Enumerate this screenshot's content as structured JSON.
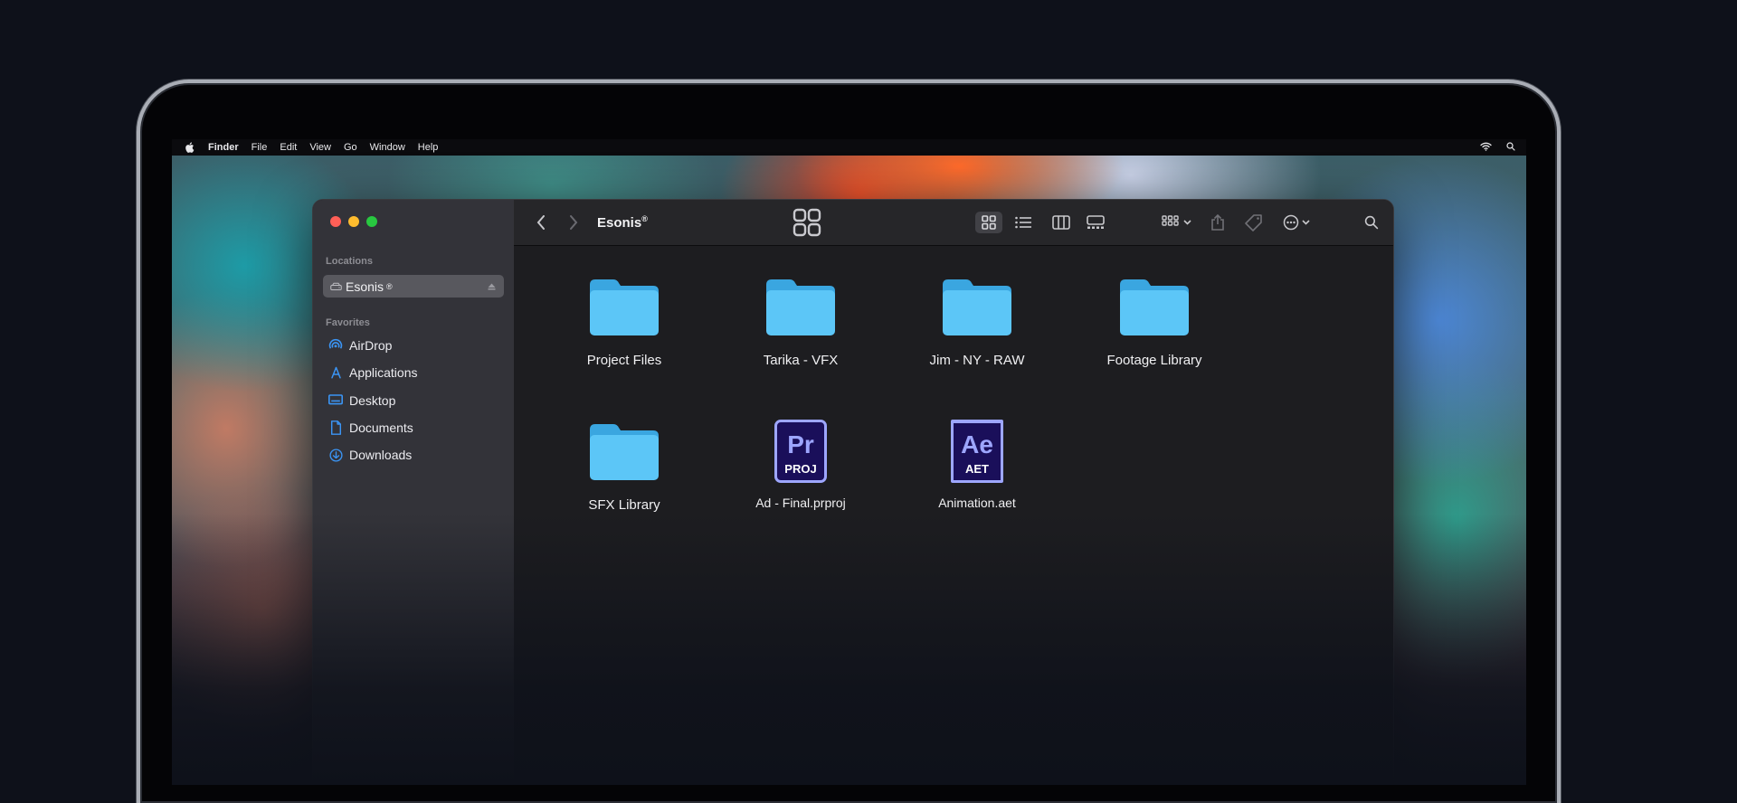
{
  "menubar": {
    "items": [
      "Finder",
      "File",
      "Edit",
      "View",
      "Go",
      "Window",
      "Help"
    ]
  },
  "window": {
    "title": "Esonis",
    "title_mark": "®"
  },
  "sidebar": {
    "locations_label": "Locations",
    "location": {
      "label": "Esonis",
      "mark": "®",
      "icon": "drive-icon"
    },
    "favorites_label": "Favorites",
    "favorites": [
      {
        "label": "AirDrop",
        "icon": "airdrop-icon"
      },
      {
        "label": "Applications",
        "icon": "applications-icon"
      },
      {
        "label": "Desktop",
        "icon": "desktop-icon"
      },
      {
        "label": "Documents",
        "icon": "document-icon"
      },
      {
        "label": "Downloads",
        "icon": "download-icon"
      }
    ]
  },
  "items": [
    {
      "label": "Project Files",
      "type": "folder"
    },
    {
      "label": "Tarika - VFX",
      "type": "folder"
    },
    {
      "label": "Jim - NY - RAW",
      "type": "folder"
    },
    {
      "label": "Footage Library",
      "type": "folder"
    },
    {
      "label": "SFX Library",
      "type": "folder"
    },
    {
      "label": "Ad - Final.prproj",
      "type": "premiere",
      "badge": "Pr",
      "ext": "PROJ"
    },
    {
      "label": "Animation.aet",
      "type": "aftereffects",
      "badge": "Ae",
      "ext": "AET"
    }
  ],
  "colors": {
    "folder": "#5cc6f7",
    "folder_dark": "#3aa6e0",
    "premiere_bg": "#1a0f5a",
    "premiere_text": "#9da6ff",
    "ae_bg": "#1a0f5a",
    "ae_text": "#9da6ff",
    "accent_blue": "#3b95f5",
    "traffic_red": "#ff5f57",
    "traffic_yellow": "#febc2e",
    "traffic_green": "#28c840"
  }
}
